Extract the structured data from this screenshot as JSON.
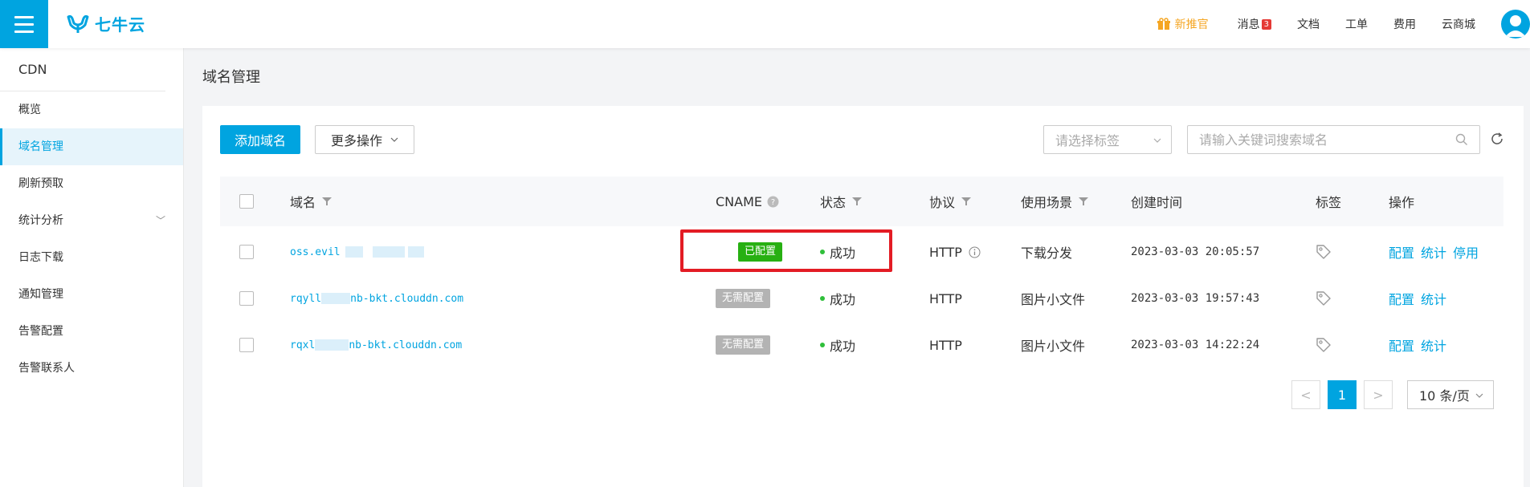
{
  "topbar": {
    "logo_text": "七牛云",
    "nav": {
      "new_guide": "新推官",
      "messages": "消息",
      "messages_badge": "3",
      "docs": "文档",
      "tickets": "工单",
      "billing": "费用",
      "store": "云商城"
    }
  },
  "sidebar": {
    "title": "CDN",
    "items": [
      {
        "label": "概览"
      },
      {
        "label": "域名管理"
      },
      {
        "label": "刷新预取"
      },
      {
        "label": "统计分析"
      },
      {
        "label": "日志下载"
      },
      {
        "label": "通知管理"
      },
      {
        "label": "告警配置"
      },
      {
        "label": "告警联系人"
      }
    ]
  },
  "main": {
    "page_title": "域名管理",
    "add_button": "添加域名",
    "more_button": "更多操作",
    "tag_select_placeholder": "请选择标签",
    "search_placeholder": "请输入关键词搜索域名",
    "table": {
      "headers": {
        "domain": "域名",
        "cname": "CNAME",
        "status": "状态",
        "protocol": "协议",
        "scene": "使用场景",
        "created": "创建时间",
        "tags": "标签",
        "actions": "操作"
      },
      "rows": [
        {
          "domain_prefix": "oss.evil",
          "domain_suffix": "",
          "cname": "已配置",
          "status": "成功",
          "protocol": "HTTP",
          "scene": "下载分发",
          "created": "2023-03-03 20:05:57",
          "actions": [
            "配置",
            "统计",
            "停用"
          ]
        },
        {
          "domain_prefix": "rqyll",
          "domain_suffix": "nb-bkt.clouddn.com",
          "cname": "无需配置",
          "status": "成功",
          "protocol": "HTTP",
          "scene": "图片小文件",
          "created": "2023-03-03 19:57:43",
          "actions": [
            "配置",
            "统计"
          ]
        },
        {
          "domain_prefix": "rqxl",
          "domain_suffix": "nb-bkt.clouddn.com",
          "cname": "无需配置",
          "status": "成功",
          "protocol": "HTTP",
          "scene": "图片小文件",
          "created": "2023-03-03 14:22:24",
          "actions": [
            "配置",
            "统计"
          ]
        }
      ]
    },
    "pagination": {
      "prev": "<",
      "current": "1",
      "next": ">",
      "page_size": "10 条/页"
    }
  },
  "colors": {
    "brand": "#00a4e0",
    "configured": "#27b012",
    "not_needed": "#b3b3b3",
    "success_dot": "#2fbf3a",
    "highlight": "#e31c24",
    "guide": "#f5a623"
  }
}
